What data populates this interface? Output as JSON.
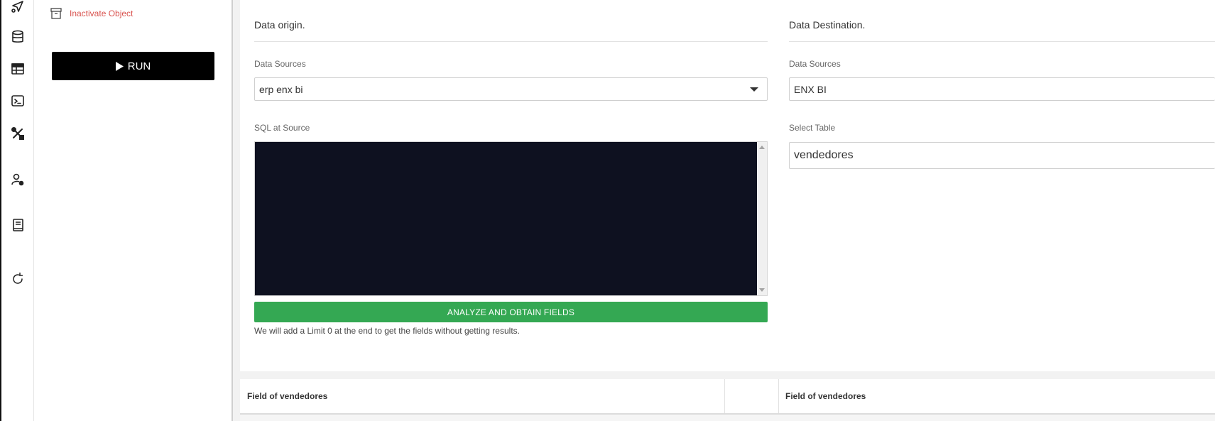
{
  "rail": {
    "icons": [
      "send-icon",
      "database-icon",
      "table-icon",
      "terminal-icon",
      "tools-icon",
      "user-settings-icon",
      "book-icon",
      "refresh-icon"
    ]
  },
  "panel": {
    "inactivate_label": "Inactivate Object",
    "run_label": "RUN"
  },
  "origin": {
    "title": "Data origin.",
    "sources_label": "Data Sources",
    "sources_value": "erp enx bi",
    "sql_label": "SQL at Source",
    "analyze_label": "ANALYZE AND OBTAIN FIELDS",
    "hint": "We will add a Limit 0 at the end to get the fields without getting results."
  },
  "destination": {
    "title": "Data Destination.",
    "sources_label": "Data Sources",
    "sources_value": "ENX BI",
    "table_label": "Select Table",
    "table_value": "vendedores"
  },
  "fields": {
    "left_header": "Field of vendedores",
    "right_header": "Field of vendedores"
  },
  "colors": {
    "accent_green": "#34a853",
    "danger_red": "#d9534f",
    "editor_bg": "#0e1120"
  }
}
